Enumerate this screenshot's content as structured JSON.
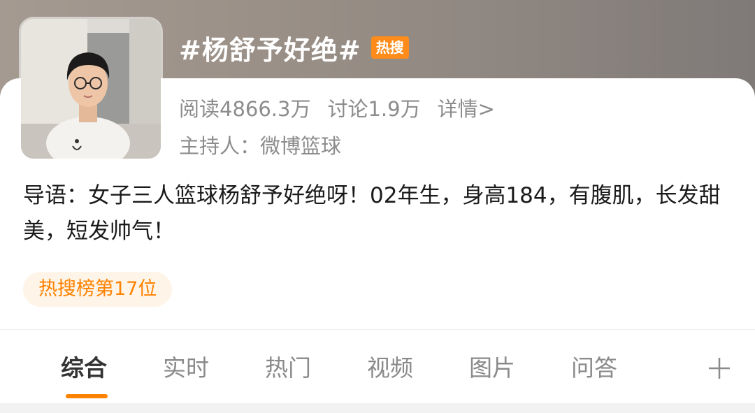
{
  "header": {
    "title": "#杨舒予好绝#",
    "hot_badge": "热搜",
    "avatar_icon": "person-photo"
  },
  "stats": {
    "reads": "阅读4866.3万",
    "discussions": "讨论1.9万",
    "details_link": "详情>"
  },
  "host": {
    "label": "主持人：微博篮球"
  },
  "intro": {
    "text": "导语：女子三人篮球杨舒予好绝呀！02年生，身高184，有腹肌，长发甜美，短发帅气！"
  },
  "rank": {
    "label": "热搜榜第17位"
  },
  "tabs": [
    {
      "label": "综合",
      "active": true
    },
    {
      "label": "实时",
      "active": false
    },
    {
      "label": "热门",
      "active": false
    },
    {
      "label": "视频",
      "active": false
    },
    {
      "label": "图片",
      "active": false
    },
    {
      "label": "问答",
      "active": false
    }
  ],
  "colors": {
    "accent": "#ff8200",
    "badge": "#ff8c1a",
    "muted_text": "#8c8c8c",
    "rank_bg": "#fff4e8"
  }
}
